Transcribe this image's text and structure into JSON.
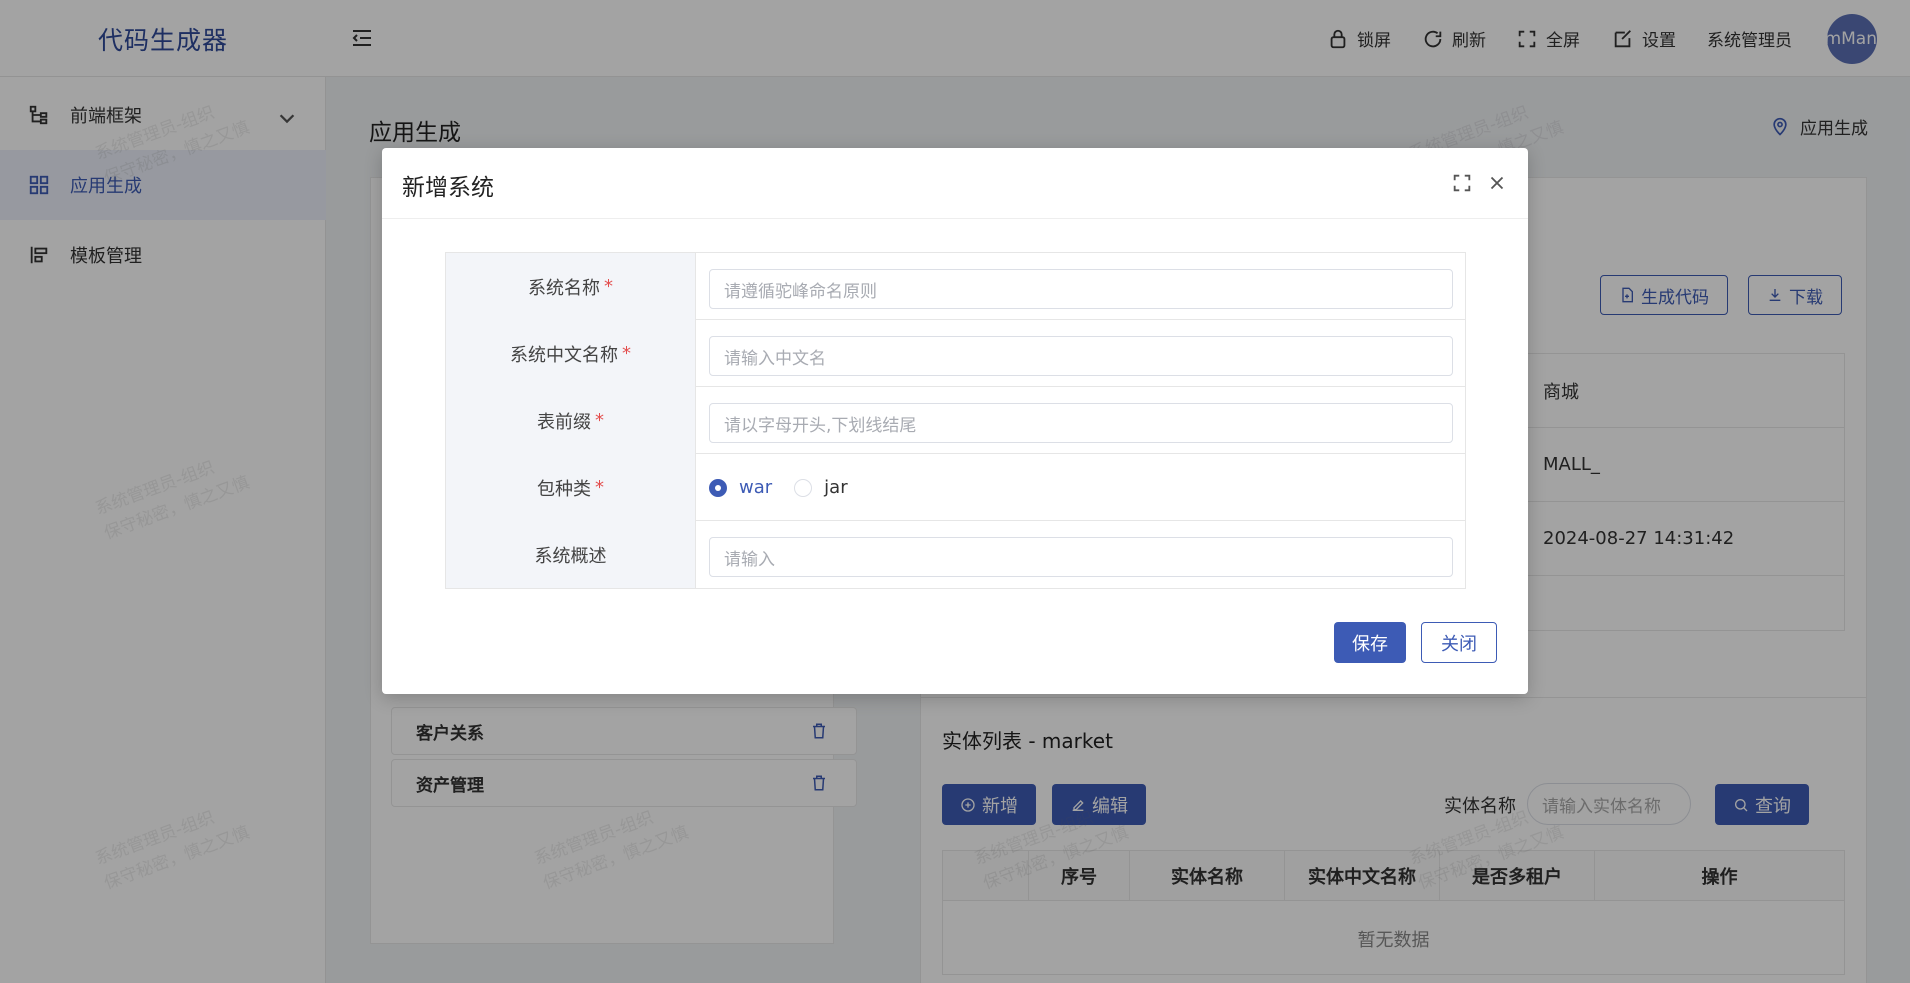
{
  "app": {
    "title": "代码生成器"
  },
  "header": {
    "lock": "锁屏",
    "refresh": "刷新",
    "fullscreen": "全屏",
    "settings": "设置",
    "user": "系统管理员",
    "avatar_text": "mMan"
  },
  "sidebar": {
    "items": [
      {
        "label": "前端框架",
        "icon": "tree-icon"
      },
      {
        "label": "应用生成",
        "icon": "grid-icon"
      },
      {
        "label": "模板管理",
        "icon": "template-icon"
      }
    ]
  },
  "page": {
    "title": "应用生成",
    "breadcrumb": "应用生成",
    "generate_btn": "生成代码",
    "download_btn": "下载",
    "info_values": [
      "商城",
      "MALL_",
      "2024-08-27 14:31:42"
    ],
    "systems": [
      "客户关系",
      "资产管理"
    ],
    "entity_title": "实体列表 - market",
    "add_btn": "新增",
    "edit_btn": "编辑",
    "entity_name_label": "实体名称",
    "entity_name_placeholder": "请输入实体名称",
    "query_btn": "查询",
    "table_columns": [
      "",
      "序号",
      "实体名称",
      "实体中文名称",
      "是否多租户",
      "操作"
    ],
    "empty_text": "暂无数据"
  },
  "watermark": {
    "line1": "系统管理员-组织",
    "line2": "保守秘密，慎之又慎"
  },
  "modal": {
    "title": "新增系统",
    "fields": [
      {
        "label": "系统名称",
        "required": "*",
        "placeholder": "请遵循驼峰命名原则"
      },
      {
        "label": "系统中文名称",
        "required": "*",
        "placeholder": "请输入中文名"
      },
      {
        "label": "表前缀",
        "required": "*",
        "placeholder": "请以字母开头,下划线结尾"
      },
      {
        "label": "包种类",
        "required": "*",
        "options": [
          "war",
          "jar"
        ],
        "selected": "war"
      },
      {
        "label": "系统概述",
        "required": "",
        "placeholder": "请输入"
      }
    ],
    "save": "保存",
    "close": "关闭"
  },
  "colors": {
    "primary": "#3d5bb5",
    "required": "#e34d4d"
  }
}
